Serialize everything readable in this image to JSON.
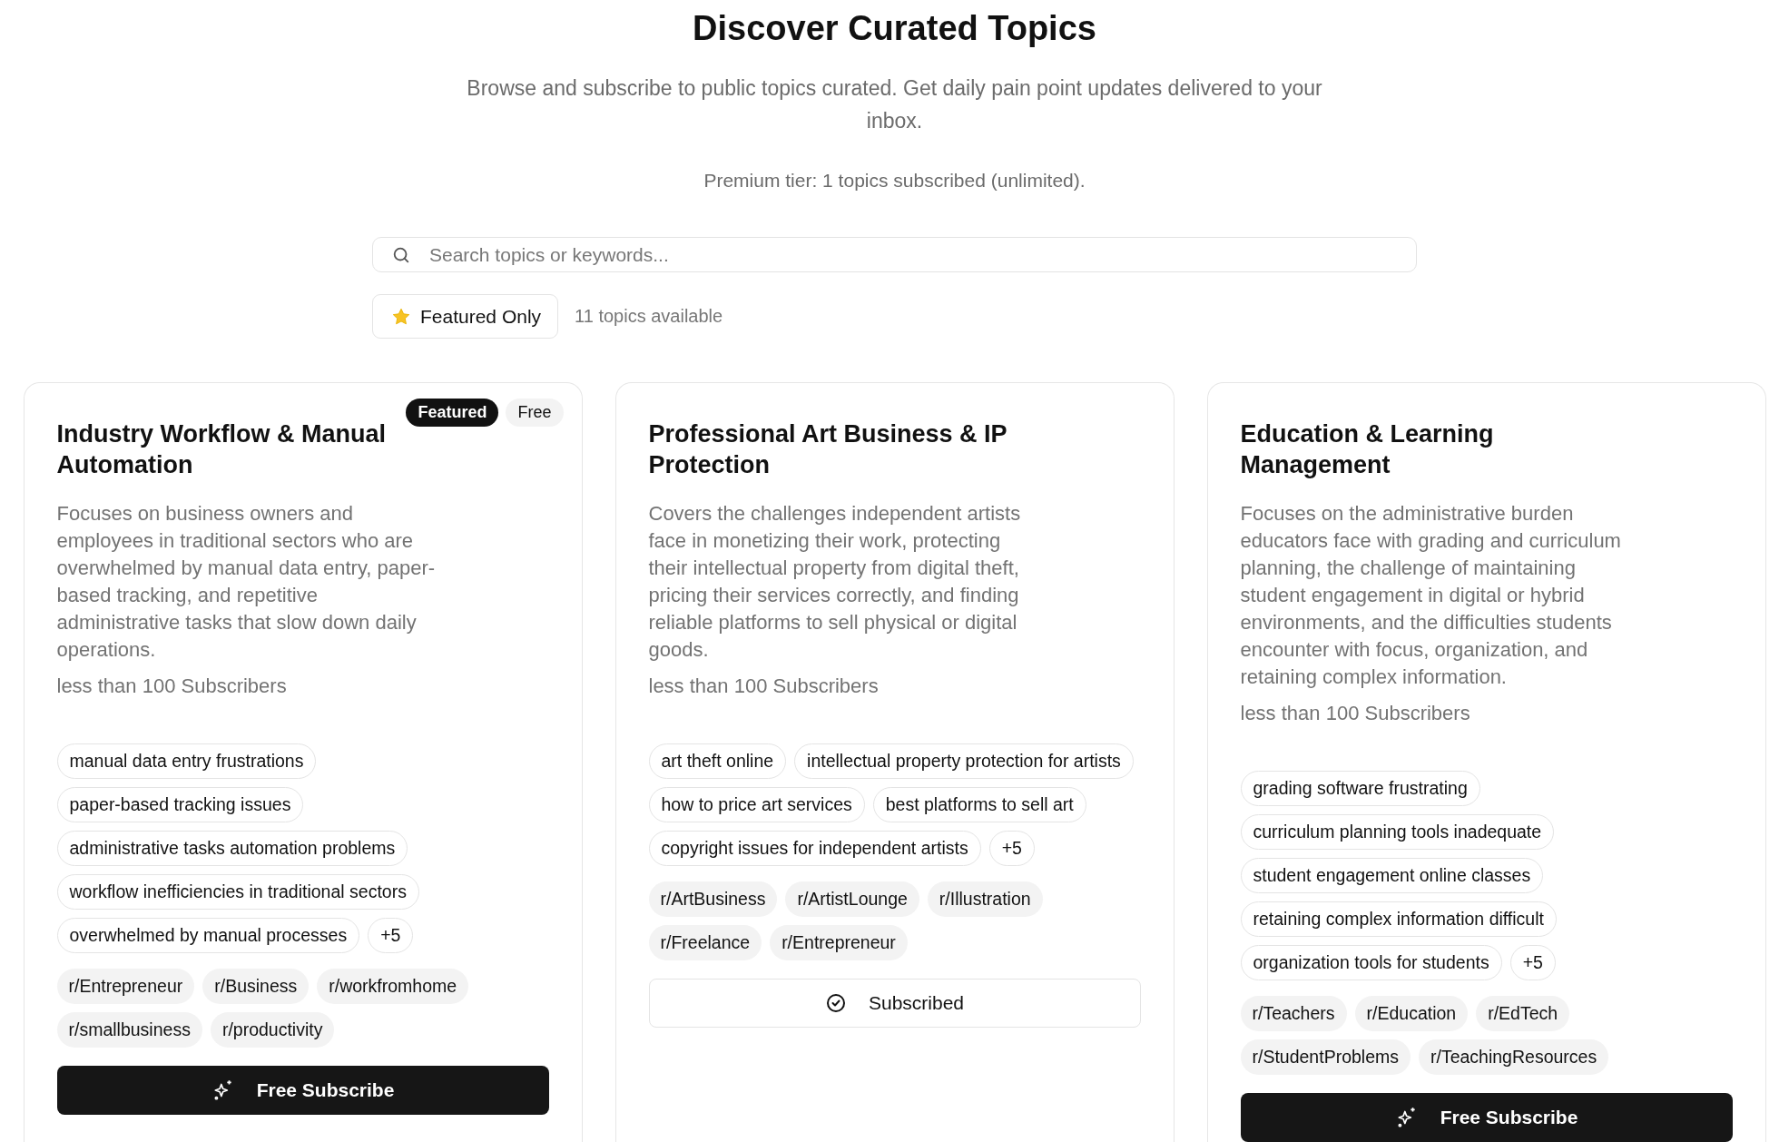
{
  "header": {
    "title": "Discover Curated Topics",
    "subtitle": "Browse and subscribe to public topics curated. Get daily pain point updates delivered to your inbox.",
    "tier_note": "Premium tier: 1 topics subscribed (unlimited)."
  },
  "search": {
    "placeholder": "Search topics or keywords..."
  },
  "filter": {
    "label": "Featured Only",
    "selected": false
  },
  "count": "11 topics available",
  "topics": [
    {
      "title": "Industry Workflow & Manual Automation",
      "badges": [
        {
          "kind": "featured",
          "label": "Featured"
        },
        {
          "kind": "price",
          "label": "Free"
        }
      ],
      "description": "Focuses on business owners and employees in traditional sectors who are overwhelmed by manual data entry, paper-based tracking, and repetitive administrative tasks that slow down daily operations.",
      "subscribers": "less than 100 Subscribers",
      "keywords": [
        "manual data entry frustrations",
        "paper-based tracking issues",
        "administrative tasks automation problems",
        "workflow inefficiencies in traditional sectors",
        "overwhelmed by manual processes"
      ],
      "more": "+5",
      "subreddits": [
        "r/Entrepreneur",
        "r/Business",
        "r/workfromhome",
        "r/smallbusiness",
        "r/productivity"
      ],
      "action": {
        "kind": "subscribe",
        "label": "Free Subscribe"
      }
    },
    {
      "title": "Professional Art Business & IP Protection",
      "description": "Covers the challenges independent artists face in monetizing their work, protecting their intellectual property from digital theft, pricing their services correctly, and finding reliable platforms to sell physical or digital goods.",
      "subscribers": "less than 100 Subscribers",
      "keywords": [
        "art theft online",
        "intellectual property protection for artists",
        "how to price art services",
        "best platforms to sell art",
        "copyright issues for independent artists"
      ],
      "more": "+5",
      "subreddits": [
        "r/ArtBusiness",
        "r/ArtistLounge",
        "r/Illustration",
        "r/Freelance",
        "r/Entrepreneur"
      ],
      "action": {
        "kind": "subscribed",
        "label": "Subscribed"
      }
    },
    {
      "title": "Education & Learning Management",
      "description": "Focuses on the administrative burden educators face with grading and curriculum planning, the challenge of maintaining student engagement in digital or hybrid environments, and the difficulties students encounter with focus, organization, and retaining complex information.",
      "subscribers": "less than 100 Subscribers",
      "keywords": [
        "grading software frustrating",
        "curriculum planning tools inadequate",
        "student engagement online classes",
        "retaining complex information difficult",
        "organization tools for students"
      ],
      "more": "+5",
      "subreddits": [
        "r/Teachers",
        "r/Education",
        "r/EdTech",
        "r/StudentProblems",
        "r/TeachingResources"
      ],
      "action": {
        "kind": "subscribe",
        "label": "Free Subscribe"
      }
    }
  ]
}
